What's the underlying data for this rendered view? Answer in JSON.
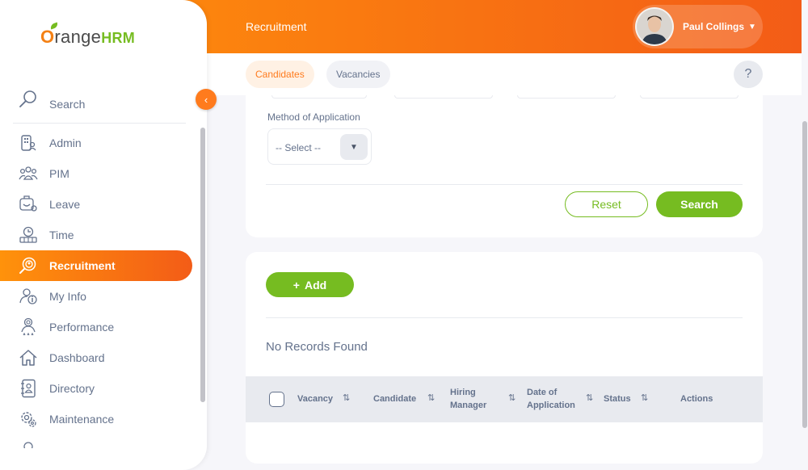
{
  "header": {
    "module_title": "Recruitment",
    "user_name": "Paul Collings"
  },
  "tabs": [
    {
      "label": "Candidates",
      "active": true
    },
    {
      "label": "Vacancies",
      "active": false
    }
  ],
  "help_label": "?",
  "sidebar": {
    "logo_prefix": "O",
    "logo_mid": "range",
    "logo_suffix": "HRM",
    "search_label": "Search",
    "items": [
      {
        "label": "Admin",
        "icon": "admin-icon"
      },
      {
        "label": "PIM",
        "icon": "pim-icon"
      },
      {
        "label": "Leave",
        "icon": "leave-icon"
      },
      {
        "label": "Time",
        "icon": "time-icon"
      },
      {
        "label": "Recruitment",
        "icon": "recruitment-icon",
        "active": true
      },
      {
        "label": "My Info",
        "icon": "my-info-icon"
      },
      {
        "label": "Performance",
        "icon": "performance-icon"
      },
      {
        "label": "Dashboard",
        "icon": "dashboard-icon"
      },
      {
        "label": "Directory",
        "icon": "directory-icon"
      },
      {
        "label": "Maintenance",
        "icon": "maintenance-icon"
      }
    ]
  },
  "filters": {
    "method_label": "Method of Application",
    "method_value": "-- Select --",
    "reset_label": "Reset",
    "search_label": "Search"
  },
  "results": {
    "add_label": "Add",
    "add_icon": "+",
    "empty_message": "No Records Found",
    "columns": [
      {
        "label": "Vacancy"
      },
      {
        "label": "Candidate"
      },
      {
        "label": "Hiring Manager"
      },
      {
        "label": "Date of Application"
      },
      {
        "label": "Status"
      },
      {
        "label": "Actions"
      }
    ]
  },
  "colors": {
    "brand_orange": "#ff7b1d",
    "brand_green": "#76bc21",
    "text": "#64728c"
  }
}
